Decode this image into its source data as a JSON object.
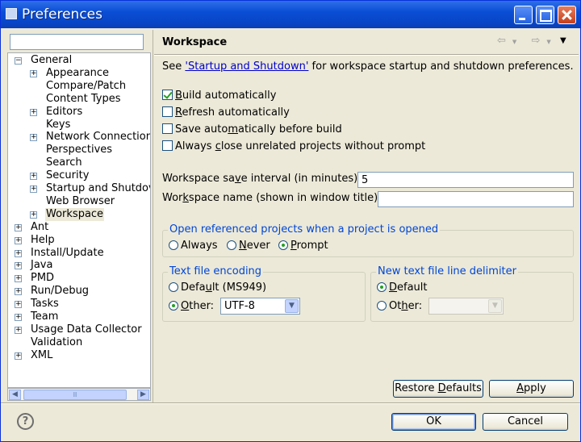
{
  "window": {
    "title": "Preferences"
  },
  "filter": {
    "value": ""
  },
  "tree": {
    "items": [
      {
        "label": "General",
        "expander": "−",
        "depth": 0,
        "selected": false
      },
      {
        "label": "Appearance",
        "expander": "+",
        "depth": 1,
        "selected": false
      },
      {
        "label": "Compare/Patch",
        "expander": "",
        "depth": 1,
        "selected": false
      },
      {
        "label": "Content Types",
        "expander": "",
        "depth": 1,
        "selected": false
      },
      {
        "label": "Editors",
        "expander": "+",
        "depth": 1,
        "selected": false
      },
      {
        "label": "Keys",
        "expander": "",
        "depth": 1,
        "selected": false
      },
      {
        "label": "Network Connection",
        "expander": "+",
        "depth": 1,
        "selected": false
      },
      {
        "label": "Perspectives",
        "expander": "",
        "depth": 1,
        "selected": false
      },
      {
        "label": "Search",
        "expander": "",
        "depth": 1,
        "selected": false
      },
      {
        "label": "Security",
        "expander": "+",
        "depth": 1,
        "selected": false
      },
      {
        "label": "Startup and Shutdov",
        "expander": "+",
        "depth": 1,
        "selected": false
      },
      {
        "label": "Web Browser",
        "expander": "",
        "depth": 1,
        "selected": false
      },
      {
        "label": "Workspace",
        "expander": "+",
        "depth": 1,
        "selected": true
      },
      {
        "label": "Ant",
        "expander": "+",
        "depth": 0,
        "selected": false
      },
      {
        "label": "Help",
        "expander": "+",
        "depth": 0,
        "selected": false
      },
      {
        "label": "Install/Update",
        "expander": "+",
        "depth": 0,
        "selected": false
      },
      {
        "label": "Java",
        "expander": "+",
        "depth": 0,
        "selected": false
      },
      {
        "label": "PMD",
        "expander": "+",
        "depth": 0,
        "selected": false
      },
      {
        "label": "Run/Debug",
        "expander": "+",
        "depth": 0,
        "selected": false
      },
      {
        "label": "Tasks",
        "expander": "+",
        "depth": 0,
        "selected": false
      },
      {
        "label": "Team",
        "expander": "+",
        "depth": 0,
        "selected": false
      },
      {
        "label": "Usage Data Collector",
        "expander": "+",
        "depth": 0,
        "selected": false
      },
      {
        "label": "Validation",
        "expander": "",
        "depth": 0,
        "selected": false
      },
      {
        "label": "XML",
        "expander": "+",
        "depth": 0,
        "selected": false
      }
    ],
    "scroll_thumb_glyph": "Ⅲ"
  },
  "page": {
    "title": "Workspace",
    "back_arrow": "⇦",
    "forward_arrow": "⇨",
    "menu_glyph": "▼",
    "desc_prefix": "See ",
    "desc_link": "'Startup and Shutdown'",
    "desc_suffix": " for workspace startup and shutdown preferences.",
    "checkboxes": [
      {
        "mnemonic": "B",
        "rest": "uild automatically",
        "pre": "",
        "checked": true
      },
      {
        "mnemonic": "R",
        "rest": "efresh automatically",
        "pre": "",
        "checked": false
      },
      {
        "pre": "Save auto",
        "mnemonic": "m",
        "rest": "atically before build",
        "checked": false
      },
      {
        "pre": "Always ",
        "mnemonic": "c",
        "rest": "lose unrelated projects without prompt",
        "checked": false
      }
    ],
    "save_interval": {
      "pre": "Workspace sa",
      "mnemonic": "v",
      "rest": "e interval (in minutes):",
      "value": "5"
    },
    "workspace_name": {
      "pre": "Wor",
      "mnemonic": "k",
      "rest": "space name (shown in window title):",
      "value": ""
    },
    "open_referenced": {
      "title": "Open referenced projects when a project is opened",
      "options": [
        {
          "pre": "",
          "mnemonic": "",
          "label": "Always",
          "checked": false
        },
        {
          "pre": "",
          "mnemonic": "N",
          "label": "ever",
          "checked": false
        },
        {
          "pre": "",
          "mnemonic": "P",
          "label": "rompt",
          "checked": true
        }
      ]
    },
    "encoding": {
      "title": "Text file encoding",
      "default_label_pre": "Defa",
      "default_label_mn": "u",
      "default_label_rest": "lt (MS949)",
      "default_checked": false,
      "other_label_pre": "",
      "other_label_mn": "O",
      "other_label_rest": "ther:",
      "other_checked": true,
      "other_value": "UTF-8"
    },
    "delimiter": {
      "title": "New text file line delimiter",
      "default_label_mn": "D",
      "default_label_rest": "efault",
      "default_checked": true,
      "other_label_pre": "Ot",
      "other_label_mn": "h",
      "other_label_rest": "er:",
      "other_checked": false,
      "other_value": ""
    },
    "restore_defaults": {
      "pre": "Restore ",
      "mnemonic": "D",
      "rest": "efaults"
    },
    "apply": {
      "pre": "",
      "mnemonic": "A",
      "rest": "pply"
    }
  },
  "footer": {
    "help_glyph": "?",
    "ok_label": "OK",
    "cancel_label": "Cancel"
  },
  "colors": {
    "group_title": "#0046d5",
    "link": "#0000cc",
    "titlebar": "#0a4ed6"
  }
}
